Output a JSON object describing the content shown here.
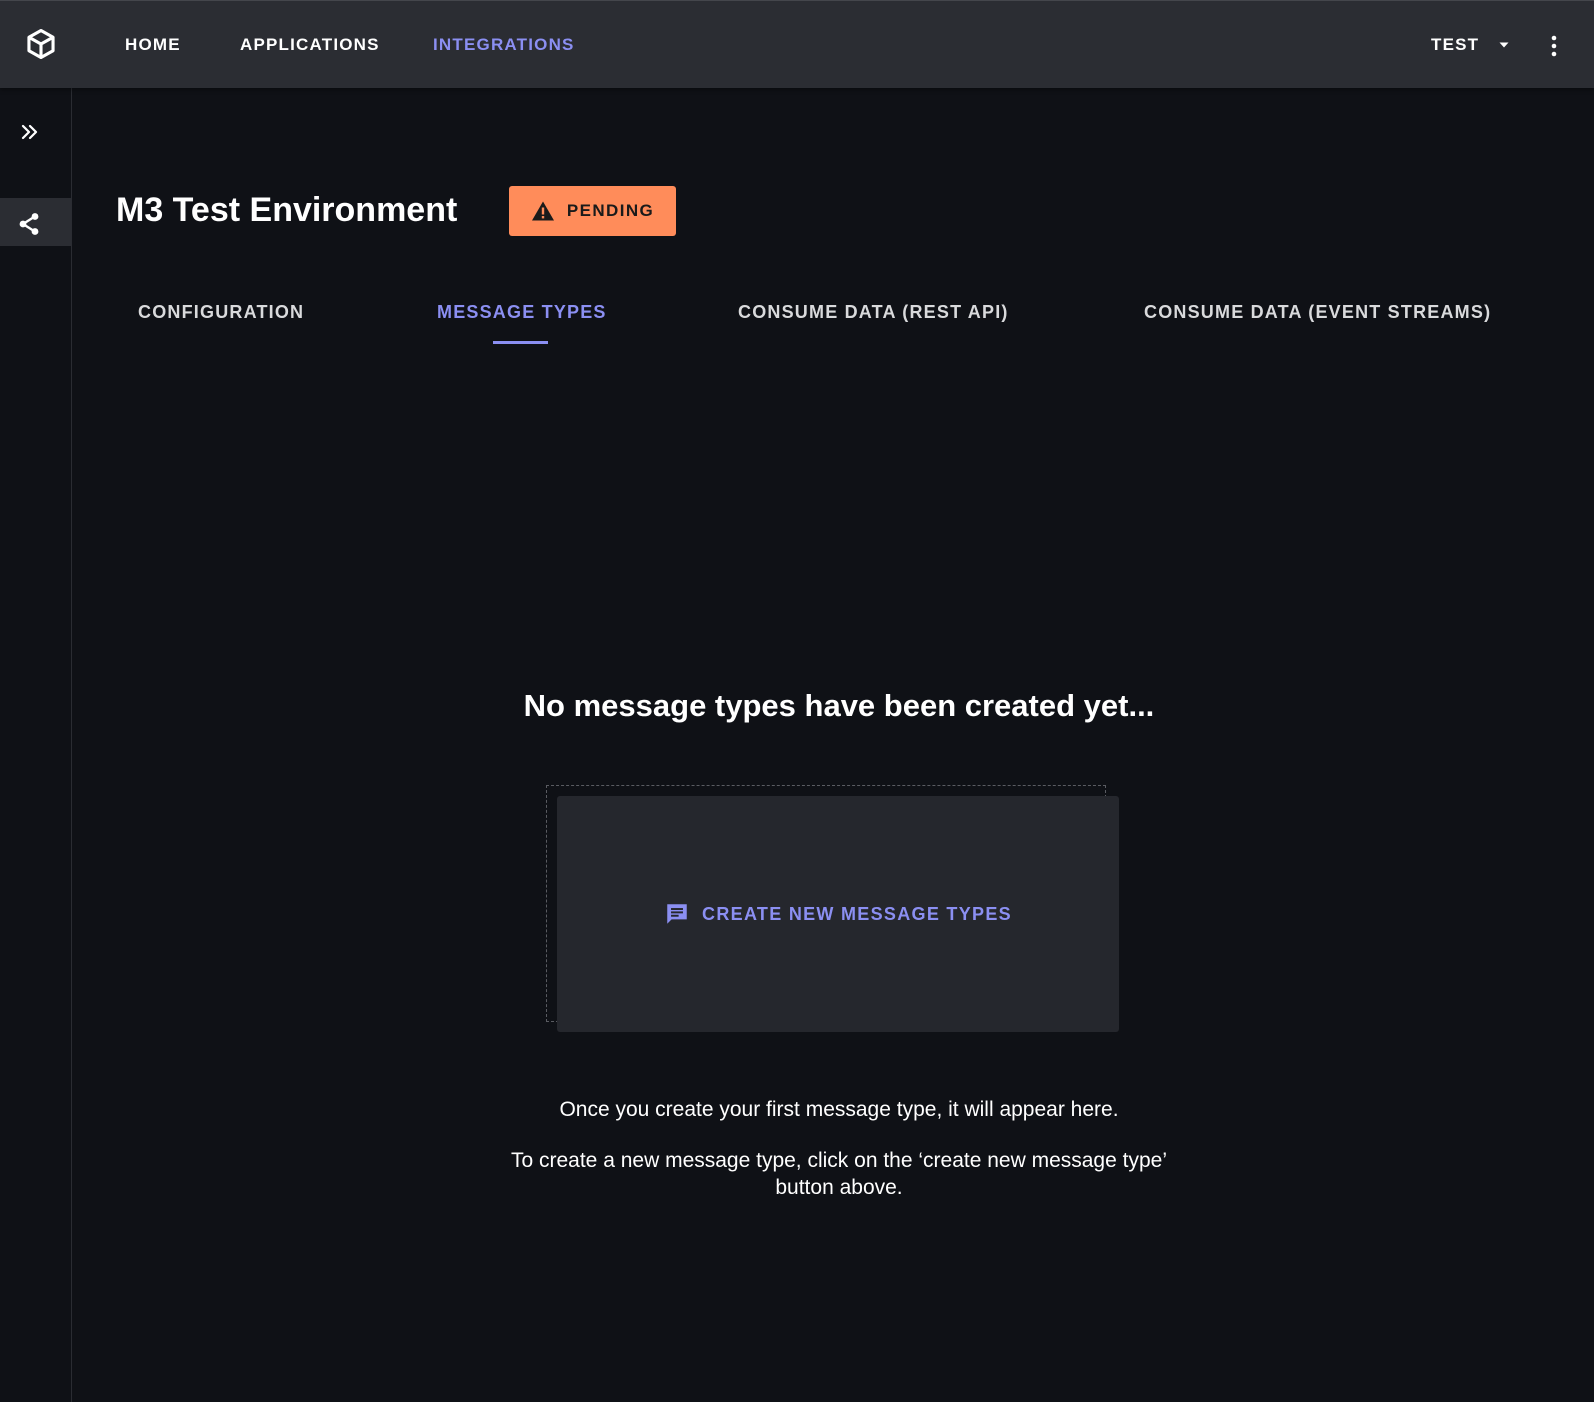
{
  "topbar": {
    "nav": {
      "home": "HOME",
      "applications": "APPLICATIONS",
      "integrations": "INTEGRATIONS"
    },
    "user": "TEST",
    "logo_icon": "cube-logo-icon",
    "menu_icon": "kebab-menu-icon"
  },
  "sidebar": {
    "expand_icon": "double-chevron-right-icon",
    "items": [
      {
        "icon": "share-icon",
        "active": true
      }
    ]
  },
  "header": {
    "title": "M3 Test Environment",
    "status": "PENDING",
    "status_icon": "warning-icon",
    "status_color": "#ff8c5a"
  },
  "tabs": [
    {
      "label": "CONFIGURATION",
      "active": false
    },
    {
      "label": "MESSAGE TYPES",
      "active": true
    },
    {
      "label": "CONSUME DATA (REST API)",
      "active": false
    },
    {
      "label": "CONSUME DATA (EVENT STREAMS)",
      "active": false
    }
  ],
  "empty_state": {
    "title": "No message types have been created yet...",
    "create_button": "CREATE NEW MESSAGE TYPES",
    "create_icon": "message-icon",
    "help_line1": "Once you create your first message type, it will appear here.",
    "help_line2": "To create a new message type, click on the ‘create new message type’ button above."
  },
  "colors": {
    "accent": "#8b8ff2",
    "background": "#0f1116",
    "topbar": "#2b2d33",
    "card": "#25272d"
  }
}
